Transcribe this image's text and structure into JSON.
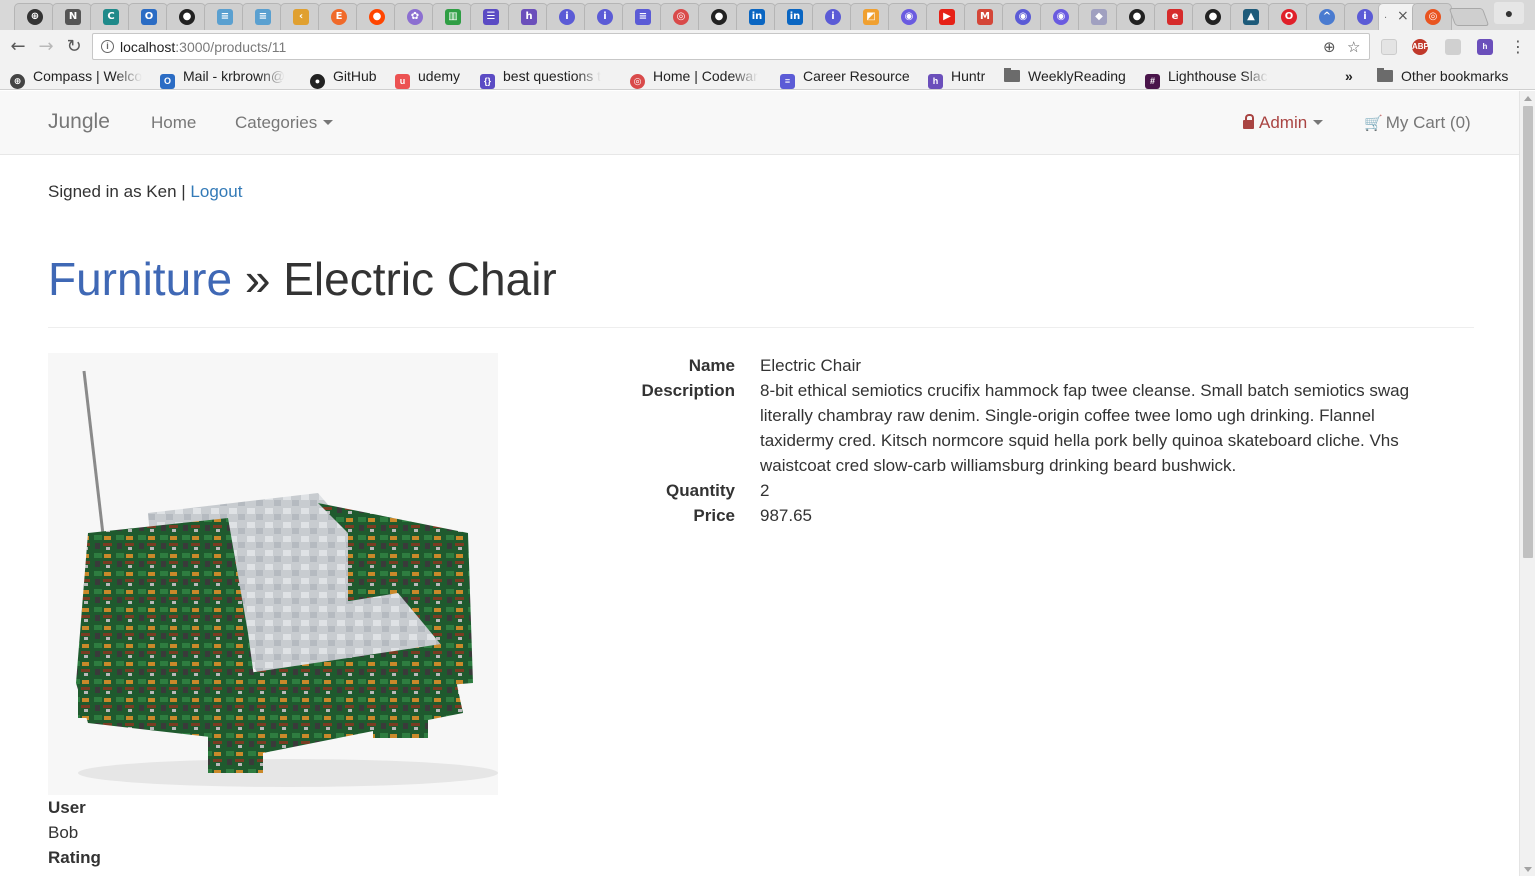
{
  "browser": {
    "url_host": "localhost",
    "url_path": ":3000/products/11",
    "active_tab_label": ".",
    "bookmarks": [
      {
        "label": "Compass | Welco",
        "icon": "compass-icon"
      },
      {
        "label": "Mail - krbrown@",
        "icon": "outlook-icon"
      },
      {
        "label": "GitHub",
        "icon": "github-icon"
      },
      {
        "label": "udemy",
        "icon": "udemy-icon"
      },
      {
        "label": "best questions t",
        "icon": "code-icon"
      },
      {
        "label": "Home | Codewar",
        "icon": "codewars-icon"
      },
      {
        "label": "Career Resource",
        "icon": "docs-icon"
      },
      {
        "label": "Huntr",
        "icon": "huntr-icon"
      },
      {
        "label": "WeeklyReading",
        "icon": "folder-icon"
      },
      {
        "label": "Lighthouse Slac",
        "icon": "slack-icon"
      }
    ],
    "overflow_label": "»",
    "other_bookmarks_label": "Other bookmarks"
  },
  "navbar": {
    "brand": "Jungle",
    "home": "Home",
    "categories": "Categories",
    "admin": "Admin",
    "cart": "My Cart (0)"
  },
  "session": {
    "signed_in_text": "Signed in as Ken |",
    "logout": "Logout"
  },
  "product": {
    "category": "Furniture",
    "separator": "»",
    "title": "Electric Chair",
    "labels": {
      "name": "Name",
      "description": "Description",
      "quantity": "Quantity",
      "price": "Price"
    },
    "name": "Electric Chair",
    "description": "8-bit ethical semiotics crucifix hammock fap twee cleanse. Small batch semiotics swag literally chambray raw denim. Single-origin coffee twee lomo ugh drinking. Flannel taxidermy cred. Kitsch normcore squid hella pork belly quinoa skateboard cliche. Vhs waistcoat cred slow-carb williamsburg drinking beard bushwick.",
    "quantity": "2",
    "price": "987.65"
  },
  "review": {
    "user_label": "User",
    "user": "Bob",
    "rating_label": "Rating"
  },
  "colors": {
    "link": "#337ab7",
    "category_link": "#3f68b5",
    "admin": "#a94442",
    "navbar_bg": "#f8f8f8"
  }
}
